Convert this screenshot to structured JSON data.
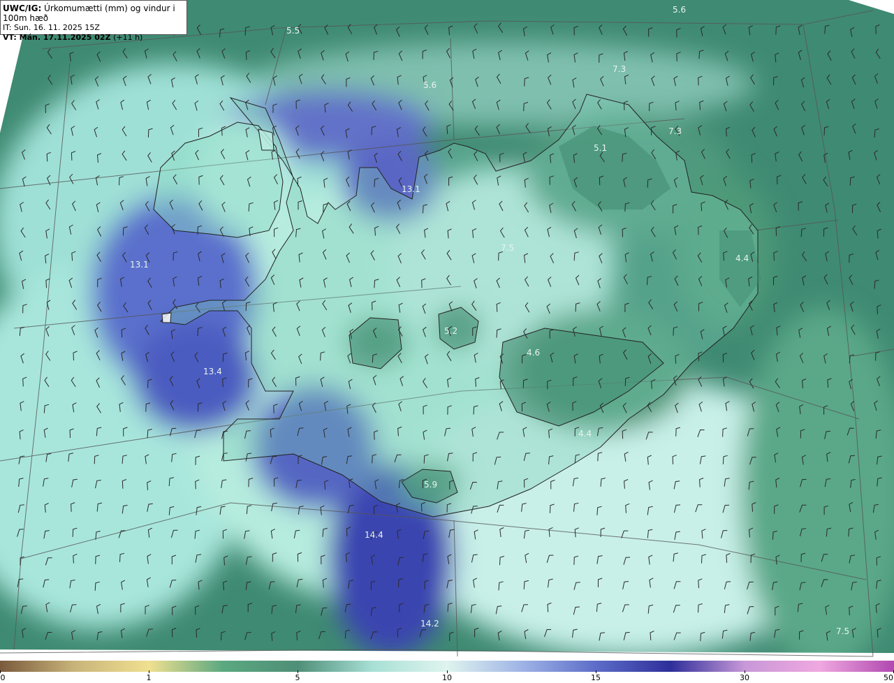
{
  "header": {
    "model": "UWC/IG:",
    "title": "Úrkomumætti (mm) og vindur i 100m hæð",
    "init_time": "IT: Sun. 16. 11. 2025 15Z",
    "valid_label": "VT: Mán. 17.11.2025 02Z",
    "valid_offset": "(+11 h)"
  },
  "colorbar": {
    "ticks": [
      {
        "label": "0",
        "value": 0
      },
      {
        "label": "1",
        "value": 1
      },
      {
        "label": "5",
        "value": 5
      },
      {
        "label": "10",
        "value": 10
      },
      {
        "label": "15",
        "value": 15
      },
      {
        "label": "30",
        "value": 30
      },
      {
        "label": "50",
        "value": 50
      }
    ],
    "colors": [
      "#7a5a3c",
      "#c8b47a",
      "#f0e090",
      "#5aa880",
      "#4f8f78",
      "#a8e0d6",
      "#dff4ee",
      "#9fb4e6",
      "#5c6cc8",
      "#2e2f9a",
      "#c898d8",
      "#f0a8e0",
      "#b048b0"
    ]
  },
  "map": {
    "region": "Iceland",
    "background_colors": {
      "sea_green": "#3f8a72",
      "teal_light": "#9fe0d6",
      "mint": "#c8f0e8",
      "blue": "#4b5cc0",
      "deep_blue": "#3a3fa8",
      "land_green": "#4d9a78"
    },
    "labels": [
      {
        "text": "5.6"
      },
      {
        "text": "5.5"
      },
      {
        "text": "5.6"
      },
      {
        "text": "7.3"
      },
      {
        "text": "7.3"
      },
      {
        "text": "5.1"
      },
      {
        "text": "13.1"
      },
      {
        "text": "7.5"
      },
      {
        "text": "4.4"
      },
      {
        "text": "13.1"
      },
      {
        "text": "5.2"
      },
      {
        "text": "4.6"
      },
      {
        "text": "13.4"
      },
      {
        "text": "4.4"
      },
      {
        "text": "5.9"
      },
      {
        "text": "14.4"
      },
      {
        "text": "14.2"
      },
      {
        "text": "7.5"
      }
    ]
  }
}
